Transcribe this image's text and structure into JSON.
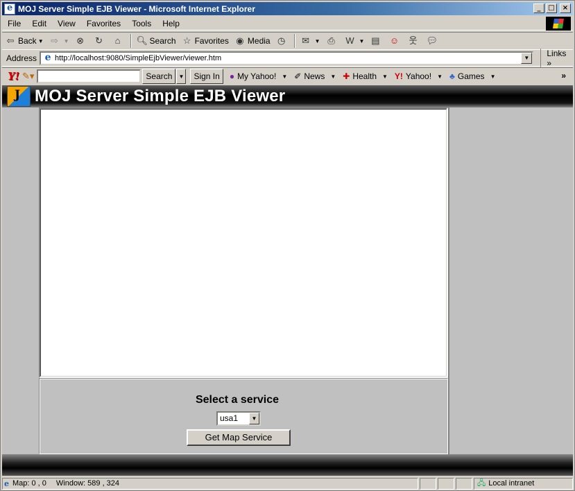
{
  "window": {
    "title": "MOJ Server Simple EJB Viewer - Microsoft Internet Explorer",
    "buttons": {
      "minimize": "_",
      "maximize": "□",
      "close": "×"
    }
  },
  "menu": [
    "File",
    "Edit",
    "View",
    "Favorites",
    "Tools",
    "Help"
  ],
  "toolbar": {
    "back": "Back",
    "search": "Search",
    "favorites": "Favorites",
    "media": "Media"
  },
  "address": {
    "label": "Address",
    "url": "http://localhost:9080/SimpleEjbViewer/viewer.htm",
    "links": "Links"
  },
  "yahoo": {
    "search_button": "Search",
    "sign_in": "Sign In",
    "items": [
      "My Yahoo!",
      "News",
      "Health",
      "Yahoo!",
      "Games"
    ]
  },
  "page": {
    "title": "MOJ Server Simple EJB Viewer",
    "select_label": "Select a service",
    "service_selected": "usa1",
    "get_button": "Get Map Service"
  },
  "status": {
    "map": "Map: 0 , 0",
    "window": "Window: 589 , 324",
    "zone": "Local intranet"
  },
  "colors": {
    "title_gradient_start": "#0a246a",
    "chrome": "#d4d0c8",
    "page_background": "#c0c0c0"
  }
}
